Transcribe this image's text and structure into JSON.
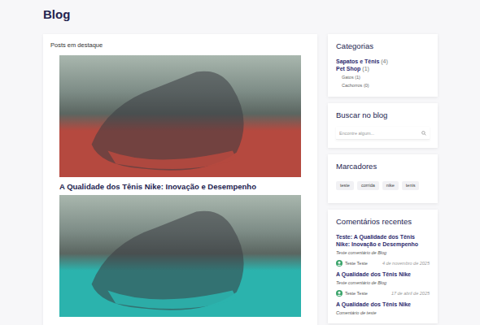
{
  "page": {
    "title": "Blog"
  },
  "featured": {
    "heading": "Posts em destaque",
    "posts": [
      {
        "title": "A Qualidade dos Tênis Nike: Inovação e Desempenho",
        "color": "#b5493f"
      },
      {
        "title": "",
        "color": "#2bb3ad"
      }
    ]
  },
  "categories": {
    "title": "Categorias",
    "items": [
      {
        "name": "Sapatos e Tênis",
        "count": "(4)",
        "children": []
      },
      {
        "name": "Pet Shop",
        "count": "(1)",
        "children": [
          {
            "name": "Gatos",
            "count": "(1)"
          },
          {
            "name": "Cachorros",
            "count": "(0)"
          }
        ]
      }
    ]
  },
  "search": {
    "title": "Buscar no blog",
    "placeholder": "Encontre algum..."
  },
  "tags": {
    "title": "Marcadores",
    "items": [
      "teste",
      "corrida",
      "nike",
      "tenis"
    ]
  },
  "comments": {
    "title": "Comentários recentes",
    "items": [
      {
        "post": "Teste: A Qualidade dos Tênis Nike: Inovação e Desempenho",
        "text": "Teste comentário de Blog",
        "author": "Teste Teste",
        "date": "4 de novembro de 2025"
      },
      {
        "post": "A Qualidade dos Tênis Nike",
        "text": "Teste comentário de Blog",
        "author": "Teste Teste",
        "date": "17 de abril de 2025"
      },
      {
        "post": "A Qualidade dos Tênis Nike",
        "text": "Comentário de teste",
        "author": "",
        "date": ""
      }
    ]
  }
}
